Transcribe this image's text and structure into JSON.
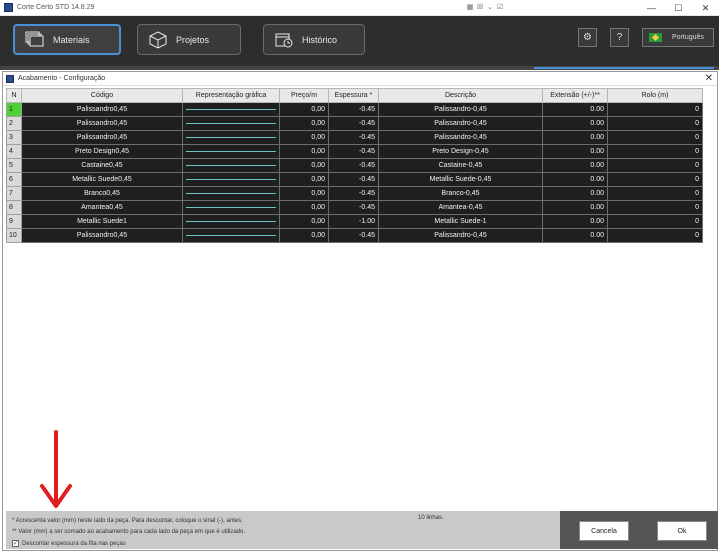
{
  "window": {
    "title": "Corte Certo STD 14.8.29",
    "controls": [
      "minimize",
      "maximize",
      "close"
    ]
  },
  "toolbar": {
    "materiais": "Materiais",
    "projetos": "Projetos",
    "historico": "Histórico",
    "language": "Português"
  },
  "dialog": {
    "title": "Acabamento - Configuração"
  },
  "table": {
    "headers": [
      "N",
      "Código",
      "Representação gráfica",
      "Preço/m",
      "Espessura *",
      "Descrição",
      "Extensão (+/-)**",
      "Rolo (m)"
    ],
    "rows": [
      {
        "n": "1",
        "codigo": "Palissandro0,45",
        "preco": "0,00",
        "esp": "-0.45",
        "desc": "Palissandro-0,45",
        "ext": "0.00",
        "rolo": "0"
      },
      {
        "n": "2",
        "codigo": "Palissandro0,45",
        "preco": "0,00",
        "esp": "-0.45",
        "desc": "Palissandro-0,45",
        "ext": "0.00",
        "rolo": "0"
      },
      {
        "n": "3",
        "codigo": "Palissandro0,45",
        "preco": "0,00",
        "esp": "-0.45",
        "desc": "Palissandro-0,45",
        "ext": "0.00",
        "rolo": "0"
      },
      {
        "n": "4",
        "codigo": "Preto Design0,45",
        "preco": "0,00",
        "esp": "-0.45",
        "desc": "Preto Design-0,45",
        "ext": "0.00",
        "rolo": "0"
      },
      {
        "n": "5",
        "codigo": "Castaine0,45",
        "preco": "0,00",
        "esp": "-0.45",
        "desc": "Castaine-0,45",
        "ext": "0.00",
        "rolo": "0"
      },
      {
        "n": "6",
        "codigo": "Metallic Suede0,45",
        "preco": "0,00",
        "esp": "-0.45",
        "desc": "Metallic Suede-0,45",
        "ext": "0.00",
        "rolo": "0"
      },
      {
        "n": "7",
        "codigo": "Branco0,45",
        "preco": "0,00",
        "esp": "-0.45",
        "desc": "Branco-0,45",
        "ext": "0.00",
        "rolo": "0"
      },
      {
        "n": "8",
        "codigo": "Amantea0,45",
        "preco": "0,00",
        "esp": "-0.45",
        "desc": "Amantea-0,45",
        "ext": "0.00",
        "rolo": "0"
      },
      {
        "n": "9",
        "codigo": "Metallic Suede1",
        "preco": "0,00",
        "esp": "-1.00",
        "desc": "Metallic Suede-1",
        "ext": "0.00",
        "rolo": "0"
      },
      {
        "n": "10",
        "codigo": "Palissandro0,45",
        "preco": "0,00",
        "esp": "-0.45",
        "desc": "Palissandro-0,45",
        "ext": "0.00",
        "rolo": "0"
      }
    ]
  },
  "footer": {
    "note1": "* Acrescenta valor (mm) neste lado da peça. Para descontar, coloque o sinal (-), antes.",
    "note2": "** Valor (mm) a ser somado ao acabamento para cada lado da peça em que é utilizado.",
    "checkbox_label": "Descontar espessura da fita nas peças",
    "lines_count": "10 linhas.",
    "cancel": "Cancela",
    "ok": "Ok"
  },
  "colors": {
    "toolbar_bg": "#2d2d2d",
    "accent": "#4a90d9",
    "selected_row_marker": "#4cd137",
    "annotation_arrow": "#e02020"
  }
}
